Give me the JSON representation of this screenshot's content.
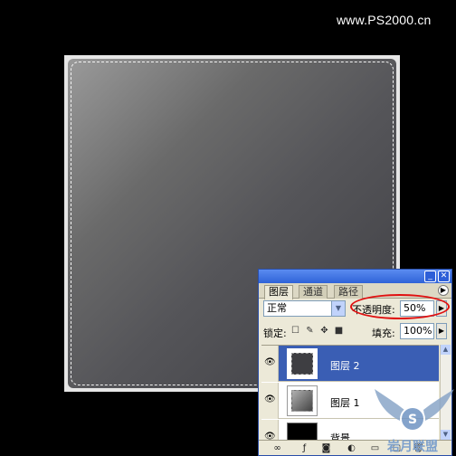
{
  "watermark": "www.PS2000.cn",
  "panel": {
    "tabs": [
      {
        "label": "图层",
        "active": true
      },
      {
        "label": "通道",
        "active": false
      },
      {
        "label": "路径",
        "active": false
      }
    ],
    "blend_mode": "正常",
    "opacity_label": "不透明度:",
    "opacity_value": "50%",
    "lock_label": "锁定:",
    "fill_label": "填充:",
    "fill_value": "100%",
    "layers": [
      {
        "name": "图层 2",
        "selected": true,
        "visible": true,
        "thumb": "dark-square"
      },
      {
        "name": "图层 1",
        "selected": false,
        "visible": true,
        "thumb": "gradient-square"
      },
      {
        "name": "背景",
        "selected": false,
        "visible": true,
        "thumb": "black"
      }
    ]
  },
  "logo_text": "岩月联盟",
  "colors": {
    "selection_blue": "#3a5eb4",
    "highlight_oval": "#e01010",
    "titlebar": "#2f63d8"
  }
}
